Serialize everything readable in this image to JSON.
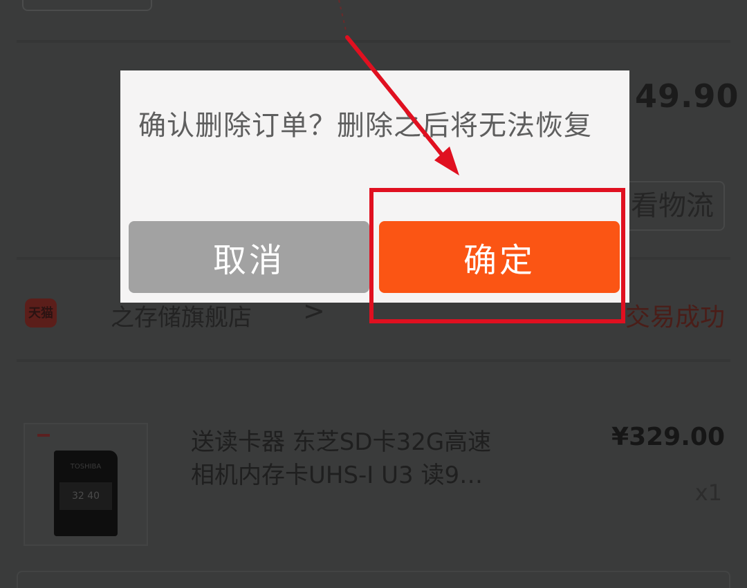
{
  "background": {
    "price_top": "49.90",
    "logistics_button_label": "看物流",
    "store": {
      "icon_text": "天猫",
      "name": "之存储旗舰店",
      "chevron": ">",
      "status": "交易成功"
    },
    "product": {
      "title_line1": "送读卡器 东芝SD卡32G高速",
      "title_line2": "相机内存卡UHS-I U3 读9…",
      "price": "¥329.00",
      "quantity": "x1",
      "card_brand": "TOSHIBA",
      "card_label": "32 40"
    }
  },
  "dialog": {
    "message": "确认删除订单？删除之后将无法恢复",
    "cancel_label": "取消",
    "confirm_label": "确定"
  },
  "colors": {
    "overlay": "#3a3b3b",
    "dialog_bg": "#f5f4f4",
    "cancel_bg": "#a2a2a2",
    "confirm_bg": "#fb5514",
    "annotation_red": "#e01020"
  }
}
